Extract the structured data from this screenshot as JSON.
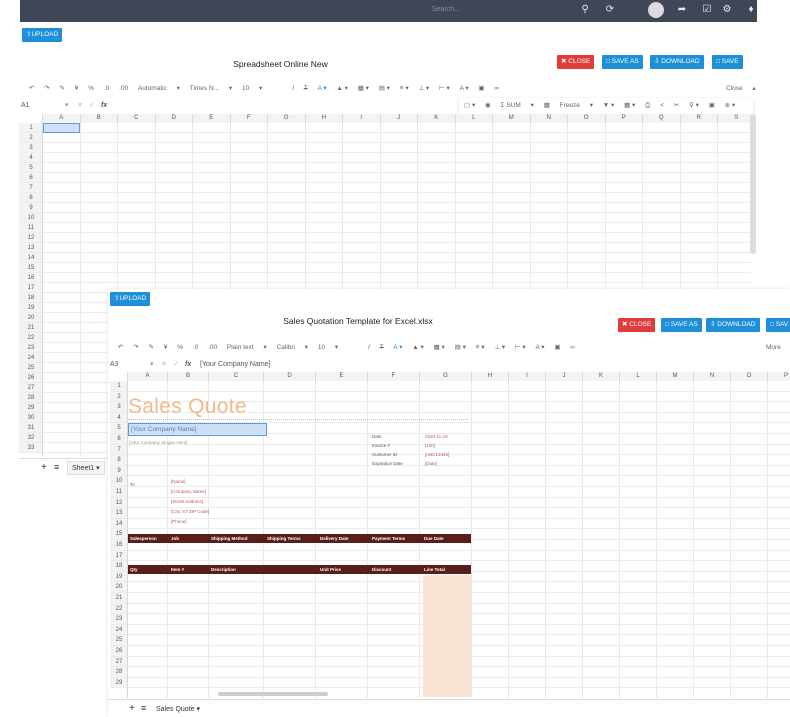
{
  "topbar": {
    "search_placeholder": "Search...",
    "icons": [
      "search-icon",
      "refresh-icon",
      "avatar",
      "share-icon",
      "check-icon",
      "settings-icon",
      "bell-icon"
    ]
  },
  "window1": {
    "upload_label": "UPLOAD",
    "title": "Spreadsheet Online New",
    "buttons": {
      "close": "CLOSE",
      "save_as": "SAVE AS",
      "download": "DOWNLOAD",
      "save": "SAVE"
    },
    "toolbar": {
      "format": "Automatic",
      "font": "Times N...",
      "size": "10",
      "close_dropdown": "Close"
    },
    "toolbar2": {
      "sum": "SUM",
      "freeze": "Freeze"
    },
    "cell_ref": "A1",
    "fx": "fx",
    "columns": [
      "A",
      "B",
      "C",
      "D",
      "E",
      "F",
      "G",
      "H",
      "I",
      "J",
      "K",
      "L",
      "M",
      "N",
      "O",
      "P",
      "Q",
      "R",
      "S"
    ],
    "rows": [
      "1",
      "2",
      "3",
      "4",
      "5",
      "6",
      "7",
      "8",
      "9",
      "10",
      "11",
      "12",
      "13",
      "14",
      "15",
      "16",
      "17",
      "18",
      "19",
      "20",
      "21",
      "22",
      "23",
      "24",
      "25",
      "26",
      "27",
      "28",
      "29",
      "30",
      "31",
      "32",
      "33"
    ],
    "sheet_tab": "Sheet1"
  },
  "window2": {
    "upload_label": "UPLOAD",
    "title": "Sales Quotation Template for Excel.xlsx",
    "buttons": {
      "close": "CLOSE",
      "save_as": "SAVE AS",
      "download": "DOWNLOAD",
      "save": "SAV"
    },
    "toolbar": {
      "format": "Plain text",
      "font": "Calibri",
      "size": "10",
      "more": "More"
    },
    "cell_ref": "A3",
    "fx": "fx",
    "formula_value": "[Your Company Name]",
    "columns": [
      "A",
      "B",
      "C",
      "D",
      "E",
      "F",
      "G",
      "H",
      "I",
      "J",
      "K",
      "L",
      "M",
      "N",
      "O",
      "P"
    ],
    "rows": [
      "1",
      "2",
      "3",
      "4",
      "5",
      "6",
      "7",
      "8",
      "9",
      "10",
      "11",
      "12",
      "13",
      "14",
      "15",
      "16",
      "17",
      "18",
      "19",
      "20",
      "21",
      "22",
      "23",
      "24",
      "25",
      "26",
      "27",
      "28",
      "29"
    ],
    "sheet_tab": "Sales Quote",
    "quote": {
      "heading": "Sales Quote",
      "company_name": "[Your Company Name]",
      "slogan": "[Your Company Slogan Here]",
      "date_label": "Date",
      "date_value": "2020-11-19",
      "invoice_label": "Invoice #",
      "invoice_value": "[100]",
      "customer_label": "Customer ID",
      "customer_value": "[ABC12345]",
      "expiration_label": "Expiration Date",
      "expiration_value": "[Date]",
      "to_label": "To",
      "address_lines": [
        "[Name]",
        "[Company Name]",
        "[Street Address]",
        "[City, ST ZIP Code]",
        "[Phone]"
      ],
      "header1": [
        "Salesperson",
        "Job",
        "Shipping Method",
        "Shipping Terms",
        "Delivery Date",
        "Payment Terms",
        "Due Date"
      ],
      "header2": [
        "Qty",
        "Item #",
        "Description",
        "Unit Price",
        "Discount",
        "Line Total"
      ]
    }
  },
  "colors": {
    "accent": "#1e8fd9",
    "danger": "#e03c3c",
    "topbar": "#3f4656",
    "table_header": "#5a1e1a",
    "quote_title": "#f2b98a",
    "line_total": "#fbe3d1"
  }
}
